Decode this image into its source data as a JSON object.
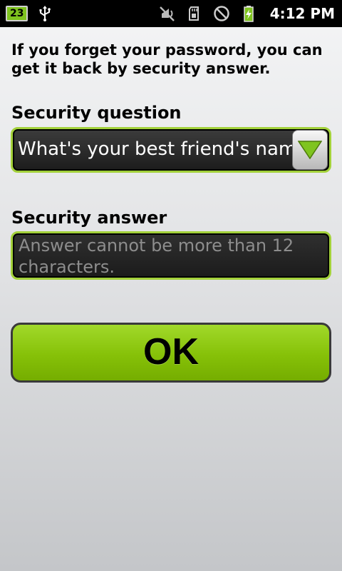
{
  "status_bar": {
    "notification_count": "23",
    "time": "4:12 PM",
    "icons": [
      "usb-icon",
      "vibrate-off-icon",
      "sd-card-icon",
      "no-signal-icon",
      "battery-charging-icon"
    ]
  },
  "intro_text": "If you forget your password, you can get it back by security answer.",
  "security_question": {
    "label": "Security question",
    "selected": "What's your best friend's name?"
  },
  "security_answer": {
    "label": "Security answer",
    "value": "",
    "placeholder": "Answer cannot be more than 12 characters."
  },
  "ok_button": {
    "label": "OK"
  },
  "colors": {
    "accent": "#8ac30a",
    "field_border": "#a3d13a",
    "field_background": "#1f1f1f"
  }
}
